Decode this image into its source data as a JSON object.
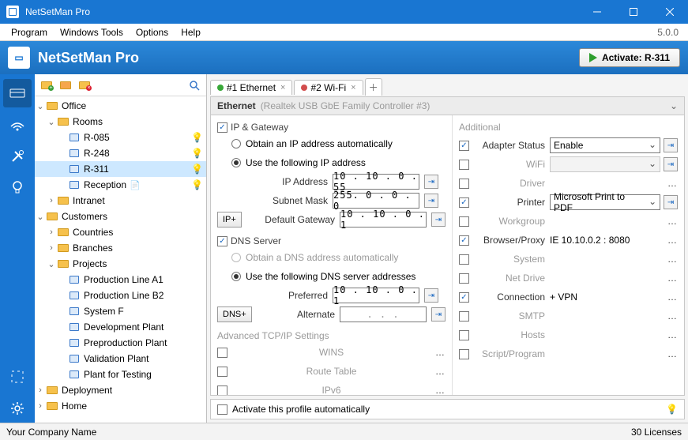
{
  "window": {
    "title": "NetSetMan Pro",
    "version": "5.0.0"
  },
  "menubar": [
    "Program",
    "Windows Tools",
    "Options",
    "Help"
  ],
  "header": {
    "appname": "NetSetMan Pro",
    "activate_label": "Activate: R-311"
  },
  "tree": {
    "root": [
      {
        "label": "Office",
        "expanded": true,
        "children": [
          {
            "label": "Rooms",
            "expanded": true,
            "children": [
              {
                "label": "R-085",
                "type": "item",
                "bulb": true
              },
              {
                "label": "R-248",
                "type": "item",
                "bulb": true
              },
              {
                "label": "R-311",
                "type": "item",
                "bulb": true,
                "selected": true
              },
              {
                "label": "Reception",
                "type": "item",
                "bulb": true,
                "note": true
              }
            ]
          },
          {
            "label": "Intranet",
            "expanded": false
          }
        ]
      },
      {
        "label": "Customers",
        "expanded": true,
        "children": [
          {
            "label": "Countries",
            "expanded": false
          },
          {
            "label": "Branches",
            "expanded": false
          },
          {
            "label": "Projects",
            "expanded": true,
            "children": [
              {
                "label": "Production Line A1",
                "type": "item"
              },
              {
                "label": "Production Line B2",
                "type": "item"
              },
              {
                "label": "System F",
                "type": "item"
              },
              {
                "label": "Development Plant",
                "type": "item"
              },
              {
                "label": "Preproduction Plant",
                "type": "item"
              },
              {
                "label": "Validation Plant",
                "type": "item"
              },
              {
                "label": "Plant for Testing",
                "type": "item"
              }
            ]
          }
        ]
      },
      {
        "label": "Deployment",
        "expanded": false
      },
      {
        "label": "Home",
        "expanded": false
      }
    ]
  },
  "tabs": [
    {
      "label": "#1 Ethernet",
      "color": "#39a839"
    },
    {
      "label": "#2 Wi-Fi",
      "color": "#d24d4d"
    }
  ],
  "adapter": {
    "name": "Ethernet",
    "detail": "(Realtek USB GbE Family Controller #3)"
  },
  "ip": {
    "section": "IP & Gateway",
    "obtain": "Obtain an IP address automatically",
    "use": "Use the following IP address",
    "ip_label": "IP Address",
    "ip": "10 . 10 .  0 . 55",
    "subnet_label": "Subnet Mask",
    "subnet": "255.  0 .  0 .  0",
    "gw_label": "Default Gateway",
    "gw": "10 . 10 .  0 .  1",
    "ipplus": "IP+"
  },
  "dns": {
    "section": "DNS Server",
    "obtain": "Obtain a DNS address automatically",
    "use": "Use the following DNS server addresses",
    "pref_label": "Preferred",
    "pref": "10 . 10 .  0 .  1",
    "alt_label": "Alternate",
    "alt": ".       .       .",
    "dnsplus": "DNS+"
  },
  "adv": {
    "section": "Advanced TCP/IP Settings",
    "wins": "WINS",
    "route": "Route Table",
    "ipv6": "IPv6"
  },
  "additional": {
    "section": "Additional",
    "rows": [
      {
        "label": "Adapter Status",
        "checked": true,
        "value": "Enable",
        "type": "select"
      },
      {
        "label": "WiFi",
        "checked": false,
        "value": "",
        "type": "select",
        "disabled": true
      },
      {
        "label": "Driver",
        "checked": false,
        "value": "",
        "type": "dots",
        "disabled": true
      },
      {
        "label": "Printer",
        "checked": true,
        "value": "Microsoft Print to PDF",
        "type": "select"
      },
      {
        "label": "Workgroup",
        "checked": false,
        "value": "",
        "type": "dots",
        "disabled": true
      },
      {
        "label": "Browser/Proxy",
        "checked": true,
        "value": "IE 10.10.0.2 : 8080",
        "type": "text"
      },
      {
        "label": "System",
        "checked": false,
        "value": "",
        "type": "dots",
        "disabled": true
      },
      {
        "label": "Net Drive",
        "checked": false,
        "value": "",
        "type": "dots",
        "disabled": true
      },
      {
        "label": "Connection",
        "checked": true,
        "value": "+ VPN",
        "type": "text"
      },
      {
        "label": "SMTP",
        "checked": false,
        "value": "",
        "type": "dots",
        "disabled": true
      },
      {
        "label": "Hosts",
        "checked": false,
        "value": "",
        "type": "dots",
        "disabled": true
      },
      {
        "label": "Script/Program",
        "checked": false,
        "value": "",
        "type": "dots",
        "disabled": true
      }
    ]
  },
  "footer": {
    "auto": "Activate this profile automatically"
  },
  "status": {
    "company": "Your Company Name",
    "licenses": "30 Licenses"
  }
}
